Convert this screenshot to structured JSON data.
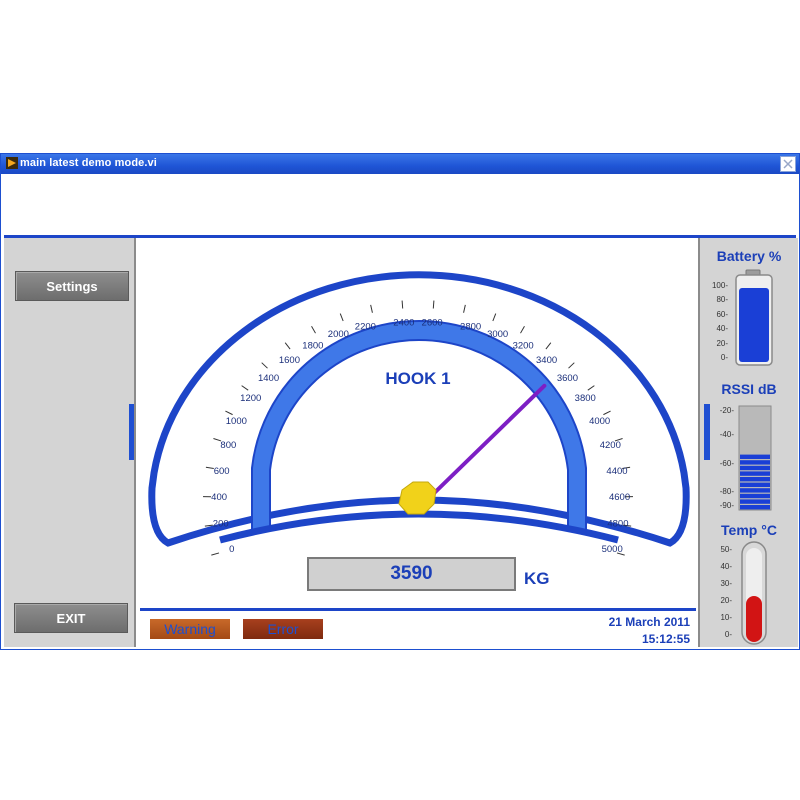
{
  "window": {
    "title": "main latest demo mode.vi"
  },
  "left": {
    "settings_label": "Settings",
    "exit_label": "EXIT"
  },
  "gauge": {
    "title": "HOOK 1",
    "value": 3590,
    "min": 0,
    "max": 5000,
    "ticks": [
      "0",
      "200",
      "400",
      "600",
      "800",
      "1000",
      "1200",
      "1400",
      "1600",
      "1800",
      "2000",
      "2200",
      "2400",
      "2600",
      "2800",
      "3000",
      "3200",
      "3400",
      "3600",
      "3800",
      "4000",
      "4200",
      "4400",
      "4600",
      "4800",
      "5000"
    ],
    "readout": "3590",
    "unit": "KG",
    "needle_color": "#7d1fc4",
    "hub_color": "#f1d21a",
    "accent": "#1d45c8"
  },
  "status": {
    "warning_label": "Warning",
    "error_label": "Error",
    "date": "21 March 2011",
    "time": "15:12:55"
  },
  "battery": {
    "title": "Battery %",
    "ticks": [
      "100",
      "80",
      "60",
      "40",
      "20",
      "0"
    ],
    "level": 100,
    "color": "#1a3fd6"
  },
  "rssi": {
    "title": "RSSI dB",
    "ticks": [
      "-20",
      "-40",
      "-60",
      "-80",
      "-90"
    ],
    "level_db": -50,
    "min_db": -90,
    "max_db": -20,
    "color": "#1a3fd6"
  },
  "temp": {
    "title": "Temp °C",
    "ticks": [
      "50",
      "40",
      "30",
      "20",
      "10",
      "0"
    ],
    "value": 20,
    "min": 0,
    "max": 50,
    "color": "#d21414"
  }
}
